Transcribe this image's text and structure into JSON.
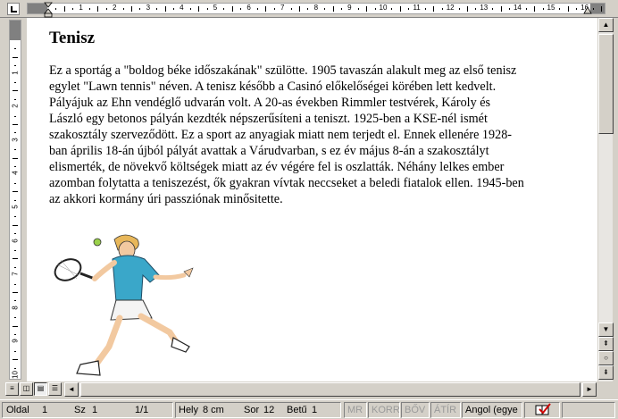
{
  "ruler": {
    "top_numbers": [
      "1",
      "2",
      "3",
      "4",
      "5",
      "6",
      "7",
      "8",
      "9",
      "10",
      "11",
      "12",
      "13",
      "14",
      "15",
      "16"
    ],
    "left_numbers": [
      "1",
      "2",
      "3",
      "4",
      "5",
      "6",
      "7",
      "8",
      "9",
      "10"
    ]
  },
  "document": {
    "title": "Tenisz",
    "body": "Ez a sportág a \"boldog béke időszakának\" szülötte. 1905 tavaszán alakult meg az első tenisz\negylet \"Lawn tennis\" néven. A tenisz később a Casinó előkelőségei körében lett kedvelt.\nPályájuk az Ehn vendéglő udvarán volt. A 20-as években Rimmler testvérek, Károly és\nLászló egy betonos pályán kezdték népszerűsíteni a teniszt. 1925-ben a KSE-nél ismét\nszakosztály szerveződött. Ez a sport az anyagiak miatt nem terjedt el. Ennek ellenére 1928-\nban április 18-án újból pályát avattak a Várudvarban, s ez év május 8-án a szakosztályt\nelismerték, de növekvő költségek miatt az év végére fel is oszlatták. Néhány lelkes ember\nazomban folytatta a teniszezést, ők gyakran vívtak neccseket a beledi fiatalok ellen. 1945-ben\naz akkori kormány úri passziónak minősitette.",
    "image_icon": "tennis-player-clipart"
  },
  "statusbar": {
    "page_label": "Oldal",
    "page_value": "1",
    "section_label": "Sz",
    "section_value": "1",
    "page_of": "1/1",
    "position_label": "Hely",
    "position_value": "8 cm",
    "line_label": "Sor",
    "line_value": "12",
    "col_label": "Betű",
    "col_value": "1",
    "mode_rec": "MR",
    "mode_trk": "KORR",
    "mode_ext": "BŐV",
    "mode_ovr": "ÁTÍR",
    "language": "Angol (egye",
    "spelling_icon": "book-check-icon"
  },
  "colors": {
    "chrome": "#d4d0c8",
    "page": "#ffffff",
    "shirt": "#3aa7c9",
    "skin": "#f2c9a0"
  }
}
